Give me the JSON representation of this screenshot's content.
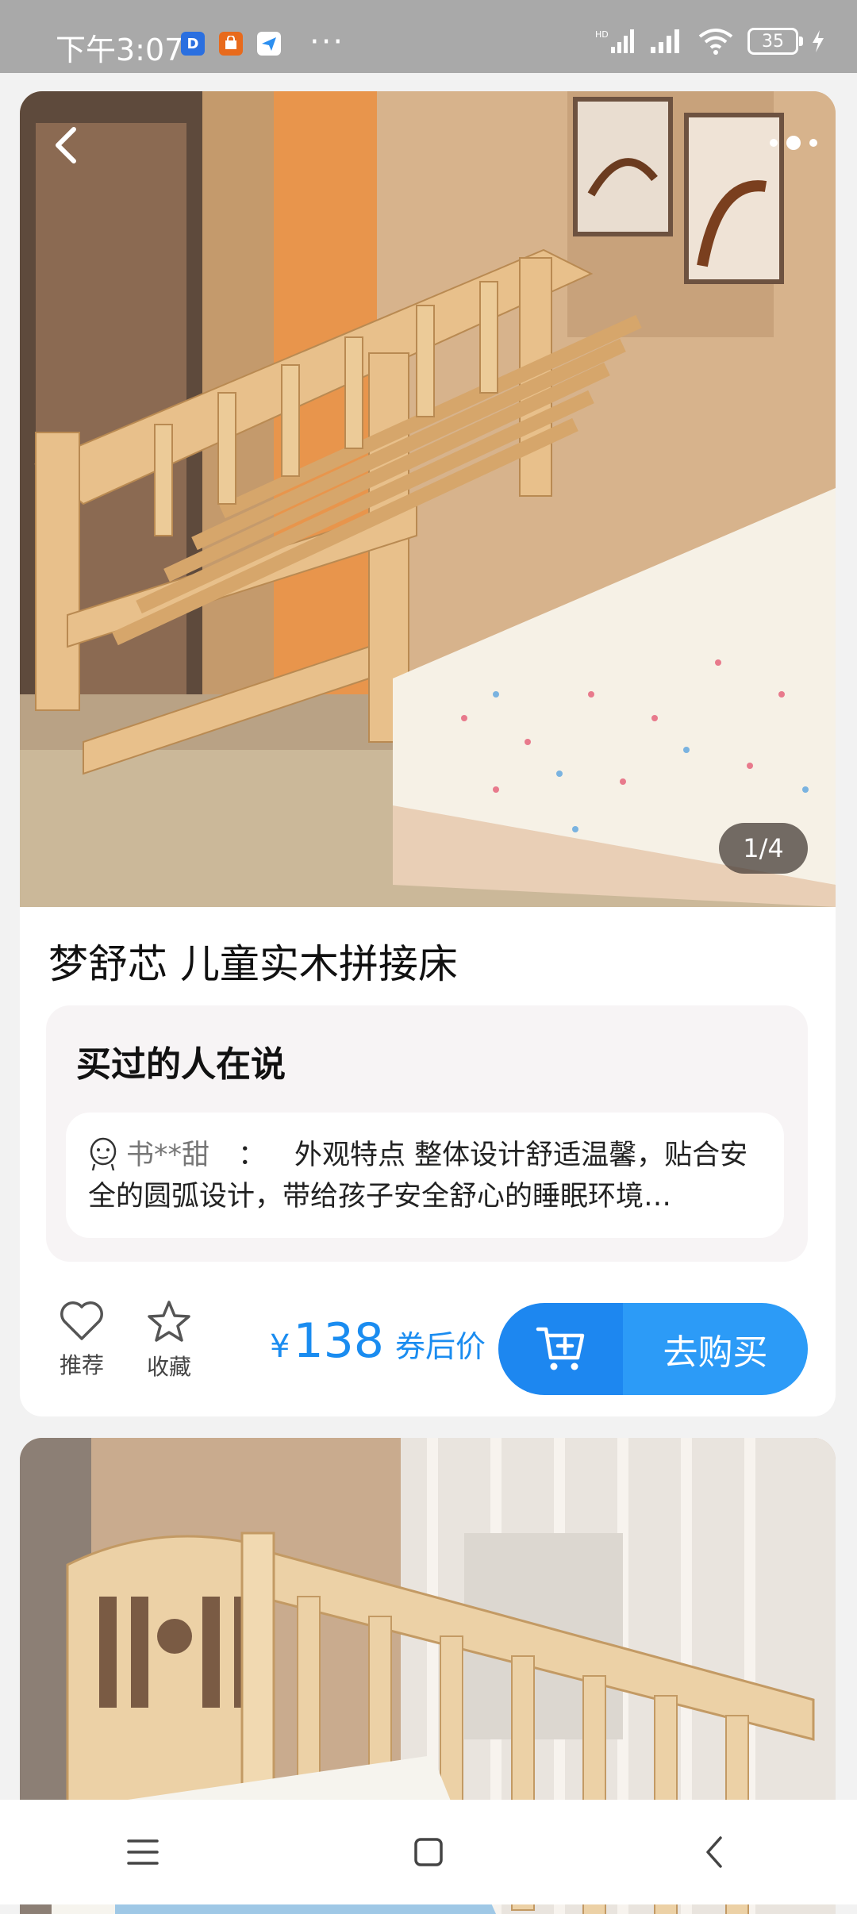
{
  "status_bar": {
    "time": "下午3:07",
    "apps": [
      {
        "icon": "d-app-icon",
        "text": "D",
        "color": "#2a6fe0"
      },
      {
        "icon": "shop-app-icon",
        "text": "",
        "color": "#e86a1c"
      },
      {
        "icon": "send-app-icon",
        "text": "",
        "color": "#2c8ff0"
      }
    ],
    "more": "···",
    "battery": "35"
  },
  "product": {
    "page_indicator": "1/4",
    "title": "梦舒芯 儿童实木拼接床"
  },
  "reviews": {
    "heading": "买过的人在说",
    "user": "书**甜",
    "separator": "：",
    "text": "外观特点 整体设计舒适温馨，贴合安全的圆弧设计，带给孩子安全舒心的睡眠环境…"
  },
  "actions": {
    "recommend_label": "推荐",
    "favorite_label": "收藏",
    "price_symbol": "¥",
    "price_value": "138",
    "price_note": "券后价",
    "buy_label": "去购买"
  },
  "colors": {
    "accent": "#1a8cf0",
    "buy_button": "#2c9bf7",
    "cart_button": "#1d87f0"
  }
}
